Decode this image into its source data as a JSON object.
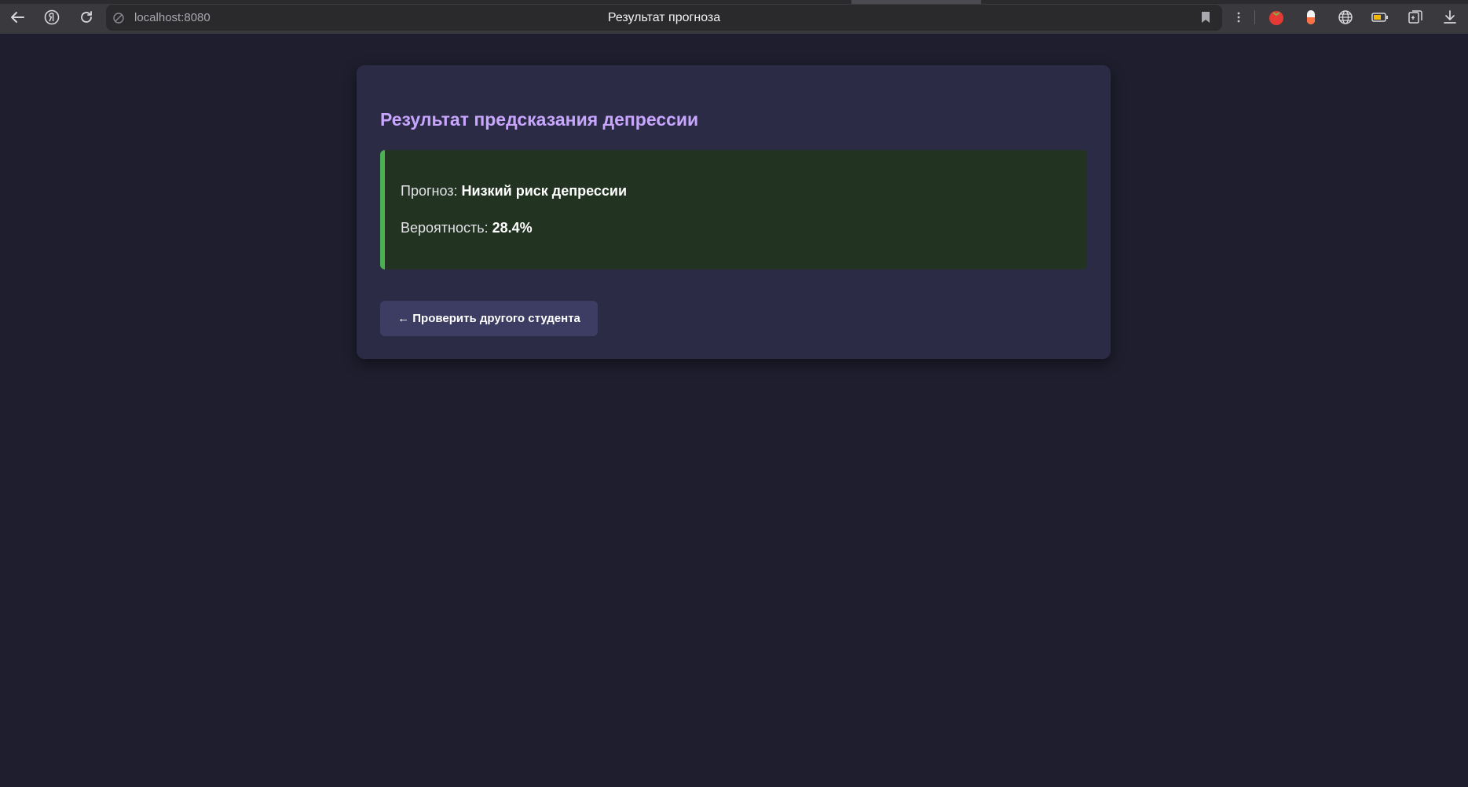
{
  "browser": {
    "url": "localhost:8080",
    "tab_title": "Результат прогноза",
    "icons": [
      "back-arrow-icon",
      "yandex-icon",
      "reload-icon",
      "site-info-icon",
      "bookmark-icon",
      "menu-dots-icon",
      "tomato-extension-icon",
      "capsule-extension-icon",
      "globe-icon",
      "battery-icon",
      "collections-icon",
      "download-icon"
    ]
  },
  "result": {
    "title": "Результат предсказания депрессии",
    "prediction_label": "Прогноз:",
    "prediction_value": "Низкий риск депрессии",
    "probability_label": "Вероятность:",
    "probability_value": "28.4%",
    "accent_color": "#4caf50",
    "title_color": "#c8a6ff"
  },
  "actions": {
    "back_label": "← Проверить другого студента"
  }
}
